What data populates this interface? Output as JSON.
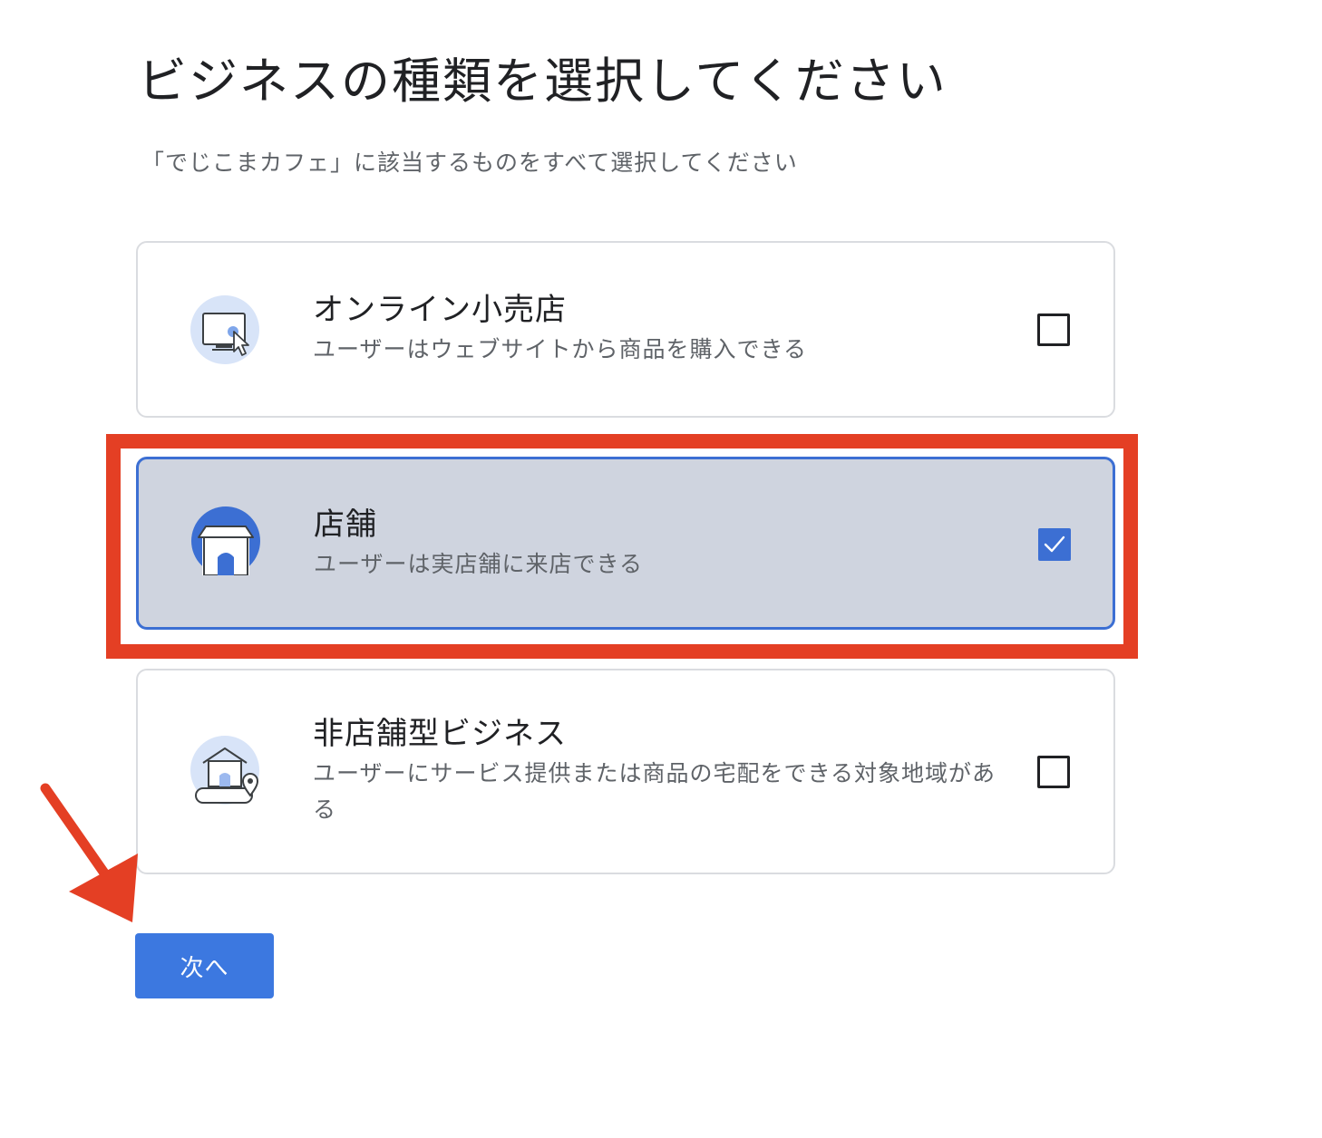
{
  "header": {
    "title": "ビジネスの種類を選択してください",
    "subtitle": "「でじこまカフェ」に該当するものをすべて選択してください"
  },
  "options": [
    {
      "title": "オンライン小売店",
      "description": "ユーザーはウェブサイトから商品を購入できる",
      "icon": "monitor-cursor-icon",
      "checked": false
    },
    {
      "title": "店舗",
      "description": "ユーザーは実店舗に来店できる",
      "icon": "storefront-icon",
      "checked": true
    },
    {
      "title": "非店舗型ビジネス",
      "description": "ユーザーにサービス提供または商品の宅配をできる対象地域がある",
      "icon": "home-delivery-icon",
      "checked": false
    }
  ],
  "footer": {
    "next_label": "次へ"
  },
  "colors": {
    "accent": "#3c6fd3",
    "button": "#3c78e0",
    "selected_bg": "#cfd4df",
    "annotation": "#e43f24"
  }
}
